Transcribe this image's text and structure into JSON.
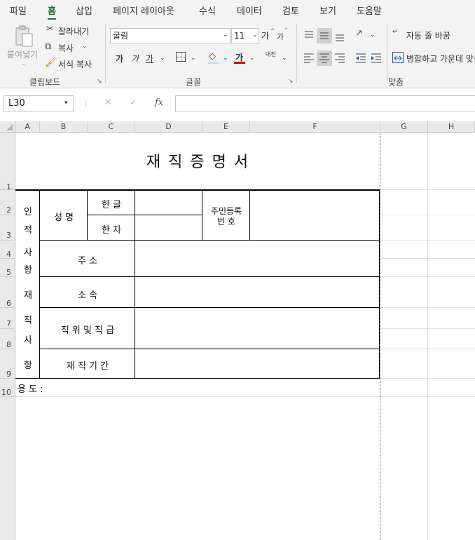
{
  "menu": [
    "파일",
    "홈",
    "삽입",
    "페이지 레이아웃",
    "수식",
    "데이터",
    "검토",
    "보기",
    "도움말"
  ],
  "clipboard": {
    "paste": "붙여넣기",
    "cut": "잘라내기",
    "copy": "복사",
    "format_painter": "서식 복사",
    "group": "클립보드"
  },
  "font": {
    "name": "굴림",
    "size": "11",
    "bold": "가",
    "italic": "가",
    "underline": "가",
    "grow": "가",
    "shrink": "가",
    "color_glyph": "가",
    "phonetic": "내천",
    "group": "글꼴"
  },
  "alignment": {
    "wrap_text": "자동 줄 바꿈",
    "merge_center": "병합하고 가운데 맞춤",
    "group": "맞춤"
  },
  "namebox": "L30",
  "fx": "fx",
  "columns": [
    "A",
    "B",
    "C",
    "D",
    "E",
    "F",
    "G",
    "H"
  ],
  "rows": [
    "1",
    "2",
    "3",
    "4",
    "5",
    "6",
    "7",
    "8",
    "9",
    "10"
  ],
  "sheet": {
    "title": "재  직  증  명  서",
    "a_in": "인",
    "a_jeok": "적",
    "a_sa": "사",
    "a_hang": "항",
    "a_jae": "재",
    "a_jik": "직",
    "a_sa2": "사",
    "a_hang2": "항",
    "name_label": "성    명",
    "hangul": "한 글",
    "hanja": "한 자",
    "resident_1": "주민등록",
    "resident_2": "번    호",
    "address": "주          소",
    "affiliation": "소          속",
    "position": "직 위 및 직 급",
    "period": "재 직 기 간",
    "purpose": "용  도 :"
  },
  "colors": {
    "accent": "#217346",
    "font_color": "#e00000"
  }
}
